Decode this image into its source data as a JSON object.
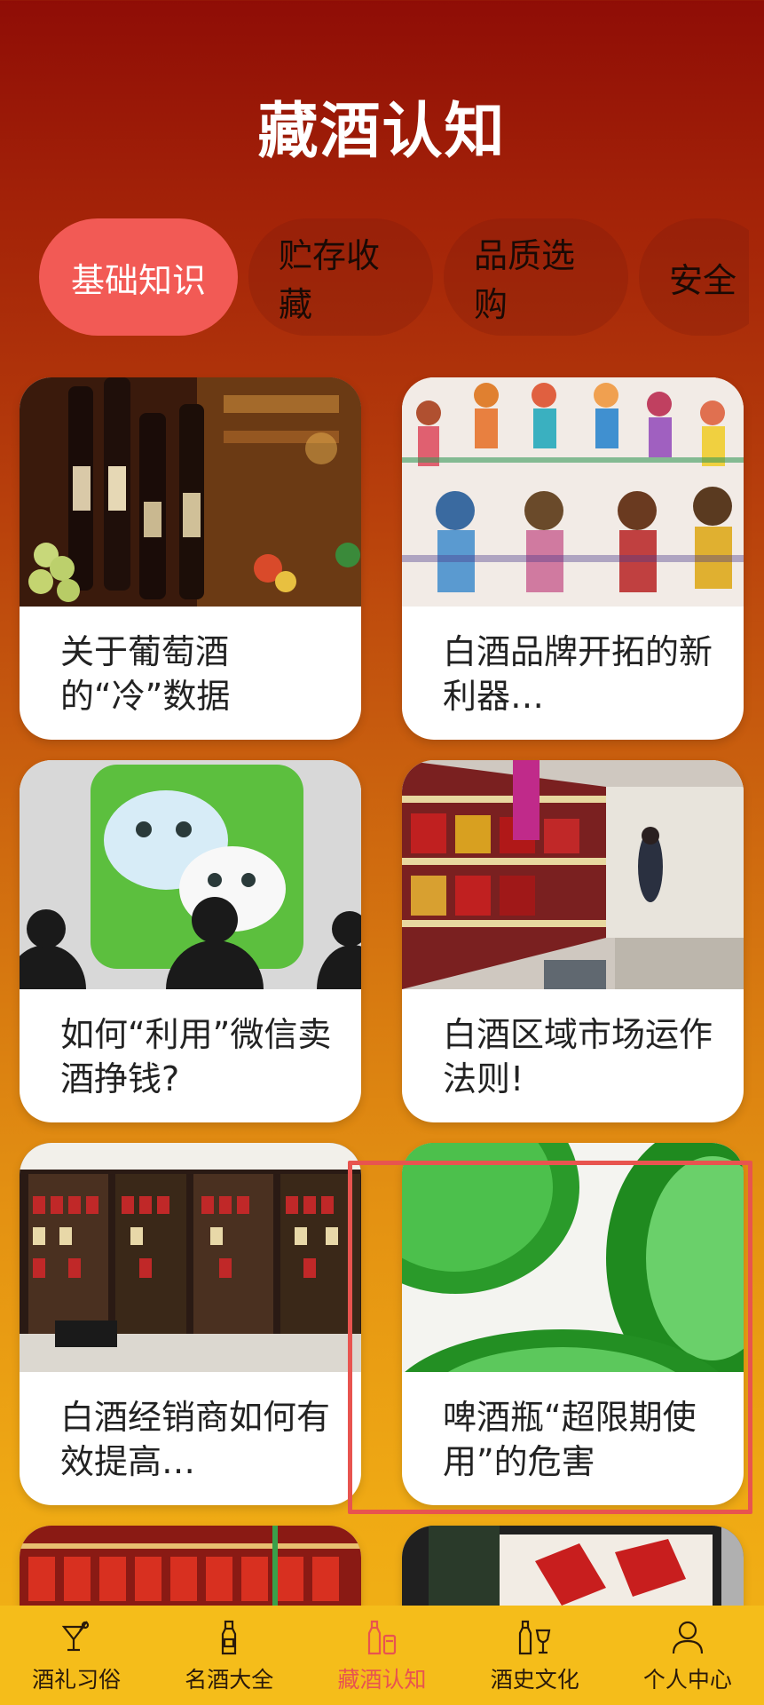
{
  "header": {
    "title": "藏酒认知"
  },
  "tabs": [
    {
      "label": "基础知识",
      "active": true
    },
    {
      "label": "贮存收藏"
    },
    {
      "label": "品质选购"
    },
    {
      "label": "安全"
    }
  ],
  "cards": [
    {
      "title": "关于葡萄酒的“冷”数据",
      "image": "wine-bottles-image"
    },
    {
      "title": "白酒品牌开拓的新利器…",
      "image": "paper-people-image"
    },
    {
      "title": "如何“利用”微信卖酒挣钱?",
      "image": "wechat-logo-image"
    },
    {
      "title": "白酒区域市场运作法则!",
      "image": "supermarket-shelves-image"
    },
    {
      "title": "白酒经销商如何有效提高…",
      "image": "liquor-store-image"
    },
    {
      "title": "啤酒瓶“超限期使用”的危害",
      "image": "green-bottles-image"
    },
    {
      "title": "",
      "image": "liquor-display-image"
    },
    {
      "title": "",
      "image": "moutai-bottle-image"
    }
  ],
  "tabbar": [
    {
      "label": "酒礼习俗",
      "icon": "cocktail-icon"
    },
    {
      "label": "名酒大全",
      "icon": "bottle-icon"
    },
    {
      "label": "藏酒认知",
      "icon": "bottles-icon",
      "active": true,
      "color": "#e8544f"
    },
    {
      "label": "酒史文化",
      "icon": "wine-glass-icon"
    },
    {
      "label": "个人中心",
      "icon": "person-icon"
    }
  ],
  "colors": {
    "accent": "#f25a55",
    "tabbar": "#f5bd1a",
    "header_top": "#8f0d06"
  }
}
